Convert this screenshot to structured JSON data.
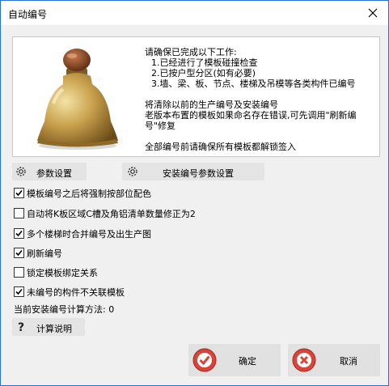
{
  "window": {
    "title": "自动编号"
  },
  "notice": {
    "line1": "请确保已完成以下工作:",
    "item1": "1.已经进行了模板碰撞检查",
    "item2": "2.已按户型分区(如有必要)",
    "item3": "3.墙、梁、板、节点、楼梯及吊模等各类构件已编号",
    "warn1": "将清除以前的生产编号及安装编号",
    "warn2a": "老版本布置的模板如果命名存在错误,可先调用\"刷新编",
    "warn2b": "号\"修复",
    "final": "全部编号前请确保所有模板都解锁签入"
  },
  "buttons": {
    "param_settings": "参数设置",
    "install_param_settings": "安装编号参数设置",
    "calc_help": "计算说明",
    "ok": "确定",
    "cancel": "取消"
  },
  "options": [
    {
      "label": "模板编号之后将强制按部位配色",
      "checked": true
    },
    {
      "label": "自动将K板区域C槽及角铝清单数量修正为2",
      "checked": false
    },
    {
      "label": "多个楼梯时合并编号及出生产图",
      "checked": true
    },
    {
      "label": "刷新编号",
      "checked": true
    },
    {
      "label": "锁定模板绑定关系",
      "checked": false
    },
    {
      "label": "未编号的构件不关联模板",
      "checked": true
    }
  ],
  "install_method": {
    "label": "当前安装编号计算方法: 0"
  },
  "colors": {
    "window_border": "#2b6fd6",
    "ok_icon": "#d9443a",
    "cancel_icon": "#d9443a"
  }
}
